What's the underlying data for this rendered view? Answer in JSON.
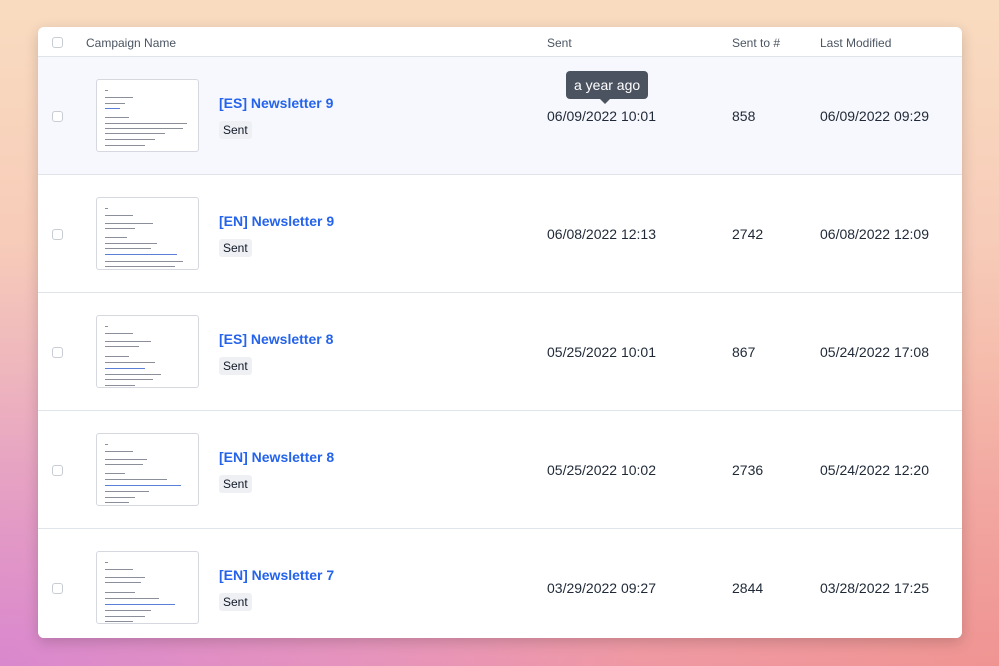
{
  "table": {
    "headers": {
      "campaign_name": "Campaign Name",
      "sent": "Sent",
      "sent_to": "Sent to #",
      "last_modified": "Last Modified"
    },
    "tooltip": "a year ago",
    "rows": [
      {
        "name": "[ES] Newsletter 9",
        "status": "Sent",
        "sent": "06/09/2022 10:01",
        "sent_to": "858",
        "last_modified": "06/09/2022 09:29"
      },
      {
        "name": "[EN] Newsletter 9",
        "status": "Sent",
        "sent": "06/08/2022 12:13",
        "sent_to": "2742",
        "last_modified": "06/08/2022 12:09"
      },
      {
        "name": "[ES] Newsletter 8",
        "status": "Sent",
        "sent": "05/25/2022 10:01",
        "sent_to": "867",
        "last_modified": "05/24/2022 17:08"
      },
      {
        "name": "[EN] Newsletter 8",
        "status": "Sent",
        "sent": "05/25/2022 10:02",
        "sent_to": "2736",
        "last_modified": "05/24/2022 12:20"
      },
      {
        "name": "[EN] Newsletter 7",
        "status": "Sent",
        "sent": "03/29/2022 09:27",
        "sent_to": "2844",
        "last_modified": "03/28/2022 17:25"
      }
    ]
  },
  "colors": {
    "link": "#2563eb",
    "row_highlight": "#f6f8fd",
    "tooltip_bg": "#4b5361"
  }
}
